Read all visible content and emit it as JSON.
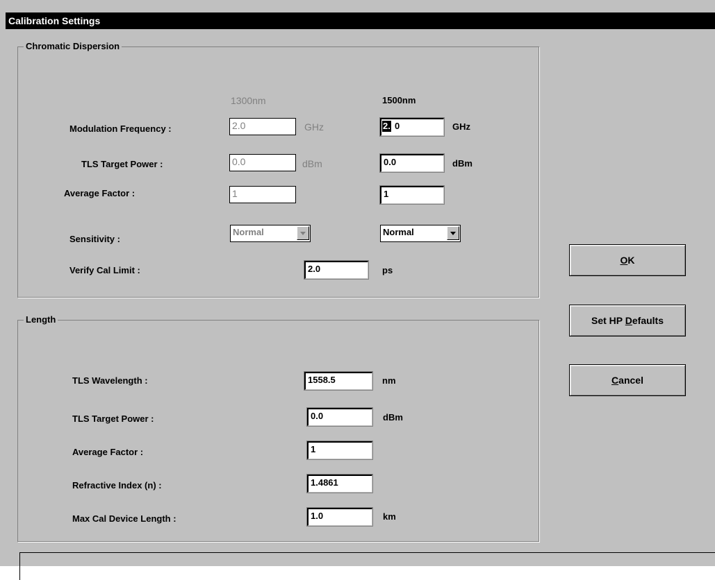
{
  "window": {
    "title": "Calibration Settings"
  },
  "chromatic_dispersion": {
    "group_label": "Chromatic Dispersion",
    "col_1300": "1300nm",
    "col_1500": "1500nm",
    "modulation_frequency": {
      "label": "Modulation Frequency :",
      "value_1300": "2.0",
      "value_1500_selected": "2.",
      "value_1500_rest": "0",
      "unit": "GHz"
    },
    "tls_target_power": {
      "label": "TLS Target Power :",
      "value_1300": "0.0",
      "value_1500": "0.0",
      "unit": "dBm"
    },
    "average_factor": {
      "label": "Average Factor :",
      "value_1300": "1",
      "value_1500": "1"
    },
    "sensitivity": {
      "label": "Sensitivity :",
      "value_1300": "Normal",
      "value_1500": "Normal"
    },
    "verify_cal_limit": {
      "label": "Verify Cal Limit :",
      "value": "2.0",
      "unit": "ps"
    }
  },
  "length": {
    "group_label": "Length",
    "tls_wavelength": {
      "label": "TLS Wavelength :",
      "value": "1558.5",
      "unit": "nm"
    },
    "tls_target_power": {
      "label": "TLS Target Power :",
      "value": "0.0",
      "unit": "dBm"
    },
    "average_factor": {
      "label": "Average Factor :",
      "value": "1"
    },
    "refractive_index": {
      "label": "Refractive Index (n) :",
      "value": "1.4861"
    },
    "max_cal_device_length": {
      "label": "Max Cal Device Length :",
      "value": "1.0",
      "unit": "km"
    }
  },
  "buttons": {
    "ok": {
      "pre": "",
      "mnemonic": "O",
      "post": "K"
    },
    "set_defaults": {
      "pre": "Set HP ",
      "mnemonic": "D",
      "post": "efaults"
    },
    "cancel": {
      "pre": "",
      "mnemonic": "C",
      "post": "ancel"
    }
  }
}
